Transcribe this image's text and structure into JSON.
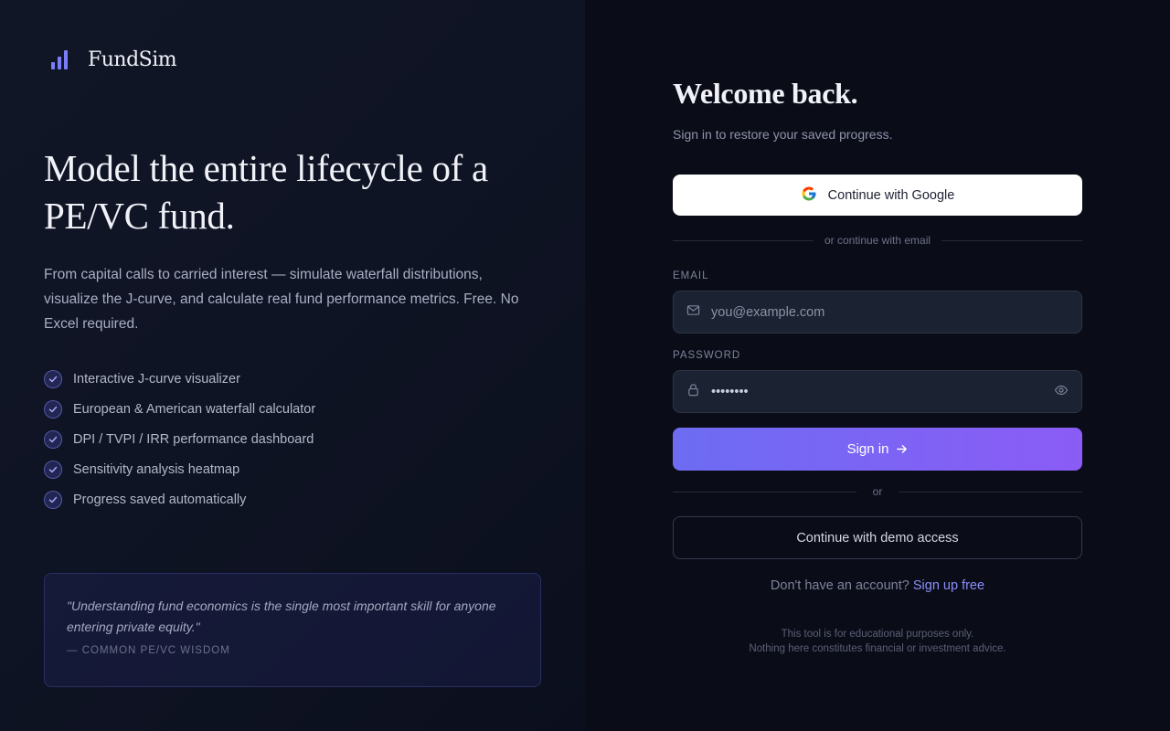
{
  "brand": {
    "name": "FundSim",
    "accent": "#7b7ff7"
  },
  "hero": {
    "headline": "Model the entire lifecycle of a PE/VC fund.",
    "description": "From capital calls to carried interest — simulate waterfall distributions, visualize the J-curve, and calculate real fund performance metrics. Free. No Excel required.",
    "features": [
      "Interactive J-curve visualizer",
      "European & American waterfall calculator",
      "DPI / TVPI / IRR performance dashboard",
      "Sensitivity analysis heatmap",
      "Progress saved automatically"
    ],
    "quote": {
      "text": "\"Understanding fund economics is the single most important skill for anyone entering private equity.\"",
      "attribution": "— COMMON PE/VC WISDOM"
    }
  },
  "auth": {
    "title": "Welcome back.",
    "subtitle": "Sign in to restore your saved progress.",
    "google_label": "Continue with Google",
    "divider_email": "or continue with email",
    "email_label": "EMAIL",
    "email_placeholder": "you@example.com",
    "password_label": "PASSWORD",
    "password_value": "••••••••",
    "signin_label": "Sign in",
    "divider_or": "or",
    "demo_label": "Continue with demo access",
    "signup_prompt": "Don't have an account?",
    "signup_link": "Sign up free",
    "disclaimer_1": "This tool is for educational purposes only.",
    "disclaimer_2": "Nothing here constitutes financial or investment advice."
  },
  "icons": {
    "logo": "bar-chart-icon",
    "google": "google-icon",
    "email": "mail-icon",
    "password": "lock-icon",
    "reveal": "eye-icon",
    "signin": "arrow-right-icon",
    "feature": "check-icon"
  },
  "colors": {
    "primary_gradient_start": "#6d6cf3",
    "primary_gradient_end": "#8b5cf6",
    "link": "#8b8ef7"
  }
}
